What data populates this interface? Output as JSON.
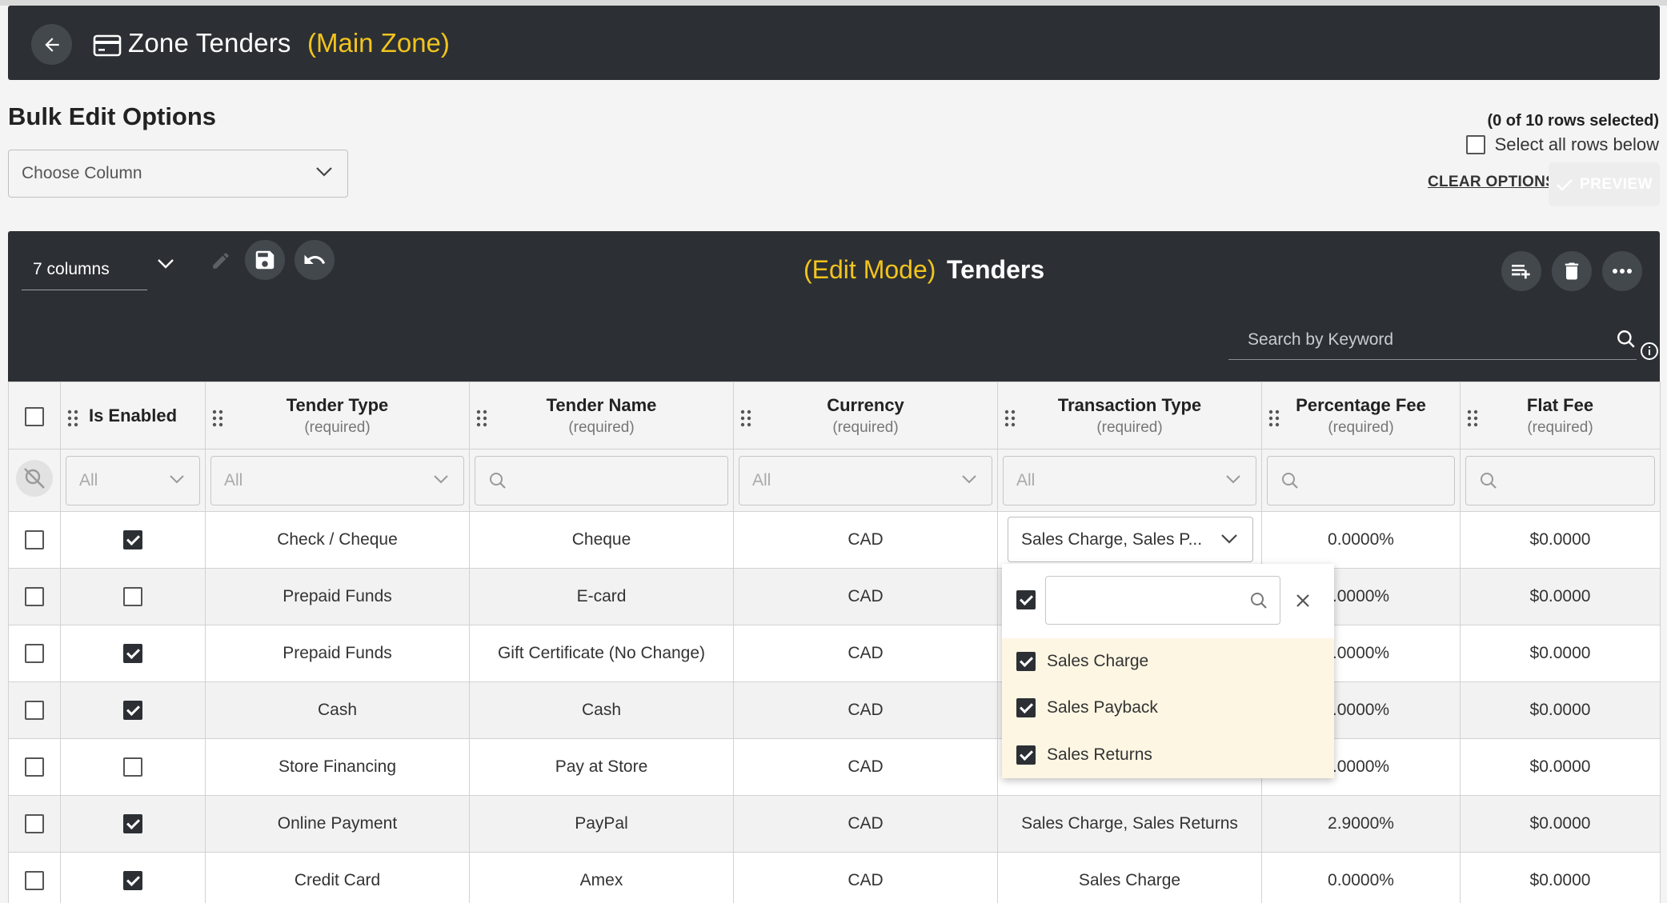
{
  "header": {
    "title": "Zone Tenders",
    "subtitle": "(Main Zone)"
  },
  "bulk": {
    "title": "Bulk Edit Options",
    "choose_column_placeholder": "Choose Column",
    "rows_selected": "(0 of 10 rows selected)",
    "select_all_label": "Select all rows below",
    "clear_options": "CLEAR OPTIONS",
    "preview": "PREVIEW"
  },
  "toolbar": {
    "columns_label": "7 columns",
    "mode_label": "(Edit Mode)",
    "title": "Tenders",
    "search_placeholder": "Search by Keyword"
  },
  "columns": [
    {
      "label": "Is Enabled",
      "req": ""
    },
    {
      "label": "Tender Type",
      "req": "(required)"
    },
    {
      "label": "Tender Name",
      "req": "(required)"
    },
    {
      "label": "Currency",
      "req": "(required)"
    },
    {
      "label": "Transaction Type",
      "req": "(required)"
    },
    {
      "label": "Percentage Fee",
      "req": "(required)"
    },
    {
      "label": "Flat Fee",
      "req": "(required)"
    }
  ],
  "filters": {
    "is_enabled": "All",
    "tender_type": "All",
    "currency": "All",
    "transaction_type": "All"
  },
  "rows": [
    {
      "selected": false,
      "enabled": true,
      "tender_type": "Check / Cheque",
      "tender_name": "Cheque",
      "currency": "CAD",
      "transaction_type": "",
      "percentage_fee": "0.0000%",
      "flat_fee": "$0.0000"
    },
    {
      "selected": false,
      "enabled": false,
      "tender_type": "Prepaid Funds",
      "tender_name": "E-card",
      "currency": "CAD",
      "transaction_type": "",
      "percentage_fee": ".0000%",
      "flat_fee": "$0.0000"
    },
    {
      "selected": false,
      "enabled": true,
      "tender_type": "Prepaid Funds",
      "tender_name": "Gift Certificate (No Change)",
      "currency": "CAD",
      "transaction_type": "",
      "percentage_fee": ".0000%",
      "flat_fee": "$0.0000"
    },
    {
      "selected": false,
      "enabled": true,
      "tender_type": "Cash",
      "tender_name": "Cash",
      "currency": "CAD",
      "transaction_type": "",
      "percentage_fee": ".0000%",
      "flat_fee": "$0.0000"
    },
    {
      "selected": false,
      "enabled": false,
      "tender_type": "Store Financing",
      "tender_name": "Pay at Store",
      "currency": "CAD",
      "transaction_type": "",
      "percentage_fee": ".0000%",
      "flat_fee": "$0.0000"
    },
    {
      "selected": false,
      "enabled": true,
      "tender_type": "Online Payment",
      "tender_name": "PayPal",
      "currency": "CAD",
      "transaction_type": "Sales Charge, Sales Returns",
      "percentage_fee": "2.9000%",
      "flat_fee": "$0.0000"
    },
    {
      "selected": false,
      "enabled": true,
      "tender_type": "Credit Card",
      "tender_name": "Amex",
      "currency": "CAD",
      "transaction_type": "Sales Charge",
      "percentage_fee": "0.0000%",
      "flat_fee": "$0.0000"
    }
  ],
  "editor": {
    "selected_value": "Sales Charge, Sales P...",
    "options": [
      {
        "label": "Sales Charge",
        "checked": true
      },
      {
        "label": "Sales Payback",
        "checked": true
      },
      {
        "label": "Sales Returns",
        "checked": true
      }
    ]
  }
}
